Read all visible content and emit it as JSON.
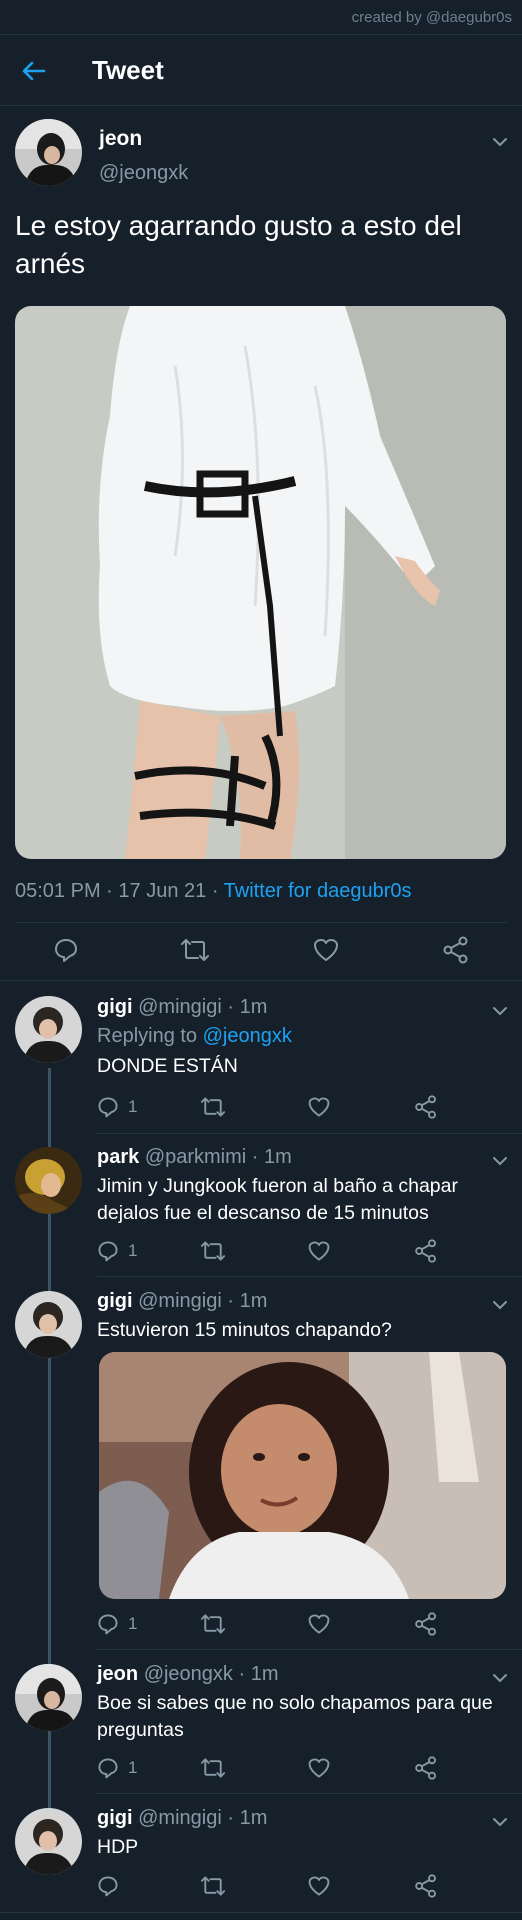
{
  "creator_credit": "created by @daegubr0s",
  "header": {
    "title": "Tweet",
    "back_icon": "arrow-left-icon",
    "accent": "#1da1f2"
  },
  "tweet": {
    "name": "jeon",
    "handle": "@jeongxk",
    "text": "Le estoy agarrando gusto a esto del arnés",
    "time": "05:01 PM",
    "date": "17 Jun 21",
    "source": "Twitter for daegubr0s",
    "actions": [
      "comment-icon",
      "retweet-icon",
      "like-icon",
      "share-icon"
    ]
  },
  "replies": [
    {
      "name": "gigi",
      "handle": "@mingigi",
      "time": "1m",
      "replying_prefix": "Replying to",
      "replying_to": "@jeongxk",
      "text": "DONDE ESTÁN",
      "reply_count": "1"
    },
    {
      "name": "park",
      "handle": "@parkmimi",
      "time": "1m",
      "text": "Jimin y Jungkook fueron al baño a chapar dejalos fue el descanso de 15 minutos",
      "reply_count": "1"
    },
    {
      "name": "gigi",
      "handle": "@mingigi",
      "time": "1m",
      "text": "Estuvieron 15 minutos chapando?",
      "reply_count": "1"
    },
    {
      "name": "jeon",
      "handle": "@jeongxk",
      "time": "1m",
      "text": "Boe si sabes que no solo chapamos para que preguntas",
      "reply_count": "1"
    },
    {
      "name": "gigi",
      "handle": "@mingigi",
      "time": "1m",
      "text": "HDP",
      "reply_count": ""
    }
  ],
  "colors": {
    "background": "#15202b",
    "muted": "#8899a6",
    "link": "#1da1f2",
    "divider": "#263340"
  }
}
